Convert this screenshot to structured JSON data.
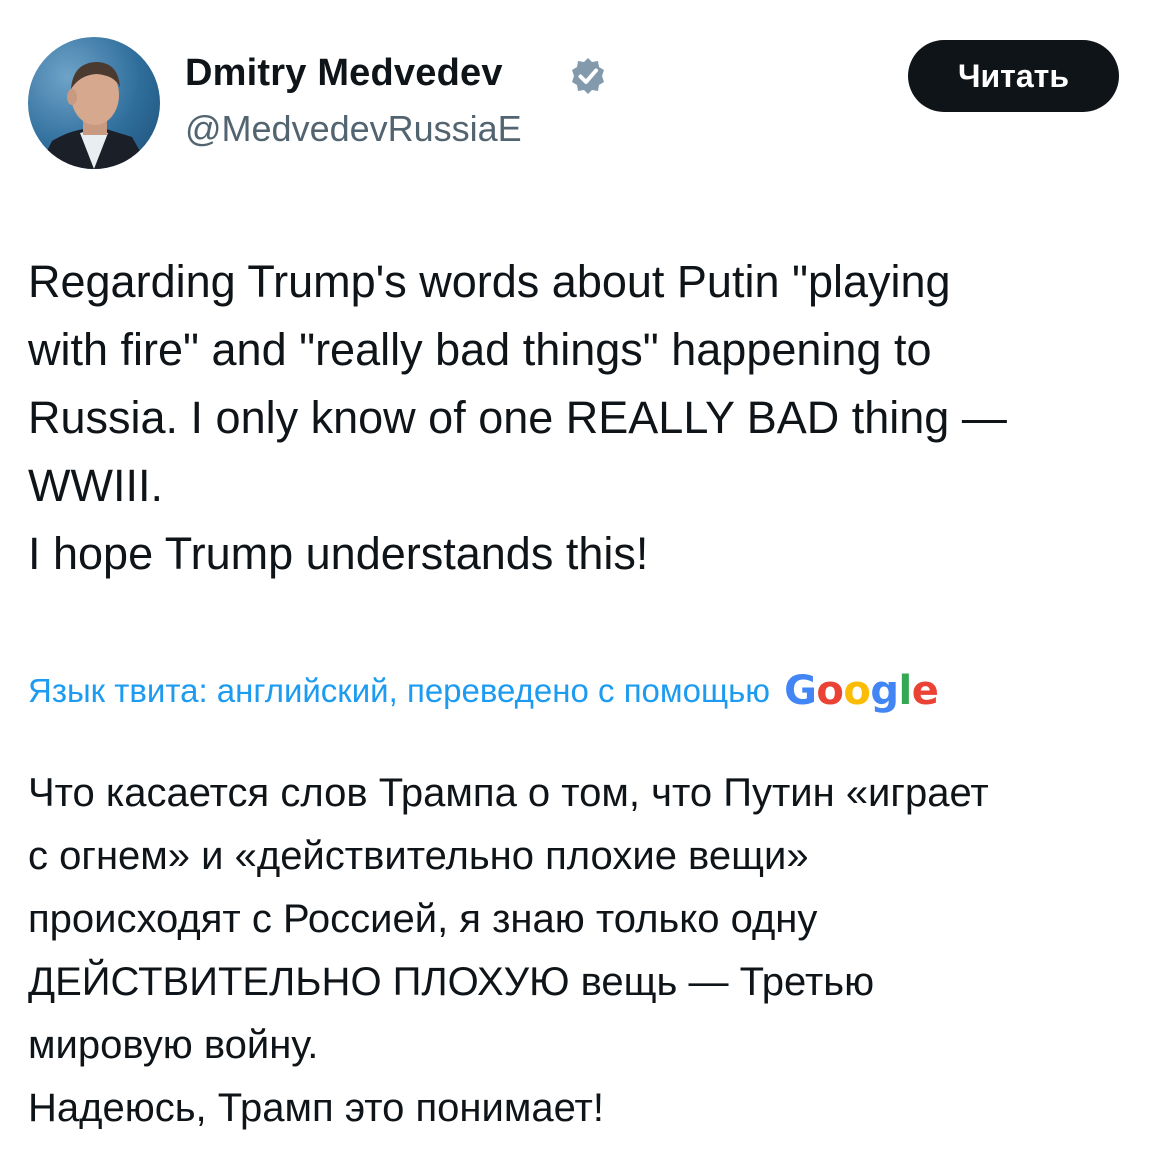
{
  "author": {
    "name": "Dmitry Medvedev",
    "handle": "@MedvedevRussiaE",
    "verified_icon": "verified-badge-icon",
    "badge_color": "#829aab"
  },
  "header": {
    "follow_label": "Читать"
  },
  "tweet": {
    "lines": [
      "Regarding Trump's words about Putin \"playing",
      "with fire\" and \"really bad things\" happening to",
      "Russia. I only know of one REALLY BAD thing —",
      "WWIII.",
      "I hope Trump understands this!"
    ]
  },
  "translation": {
    "note": "Язык твита: английский, переведено с помощью",
    "provider": {
      "letters": [
        "G",
        "o",
        "o",
        "g",
        "l",
        "e"
      ],
      "colors": [
        "#4285f4",
        "#ea4335",
        "#fbbc05",
        "#4285f4",
        "#34a853",
        "#ea4335"
      ]
    },
    "lines": [
      "Что касается слов Трампа о том, что Путин «играет",
      "с огнем» и «действительно плохие вещи»",
      "происходят с Россией, я знаю только одну",
      "ДЕЙСТВИТЕЛЬНО ПЛОХУЮ вещь — Третью",
      "мировую войну.",
      "Надеюсь, Трамп это понимает!"
    ]
  },
  "colors": {
    "text": "#0f1419",
    "secondary": "#536471",
    "link": "#1d9bf0",
    "button_bg": "#0f1419",
    "button_text": "#ffffff"
  }
}
